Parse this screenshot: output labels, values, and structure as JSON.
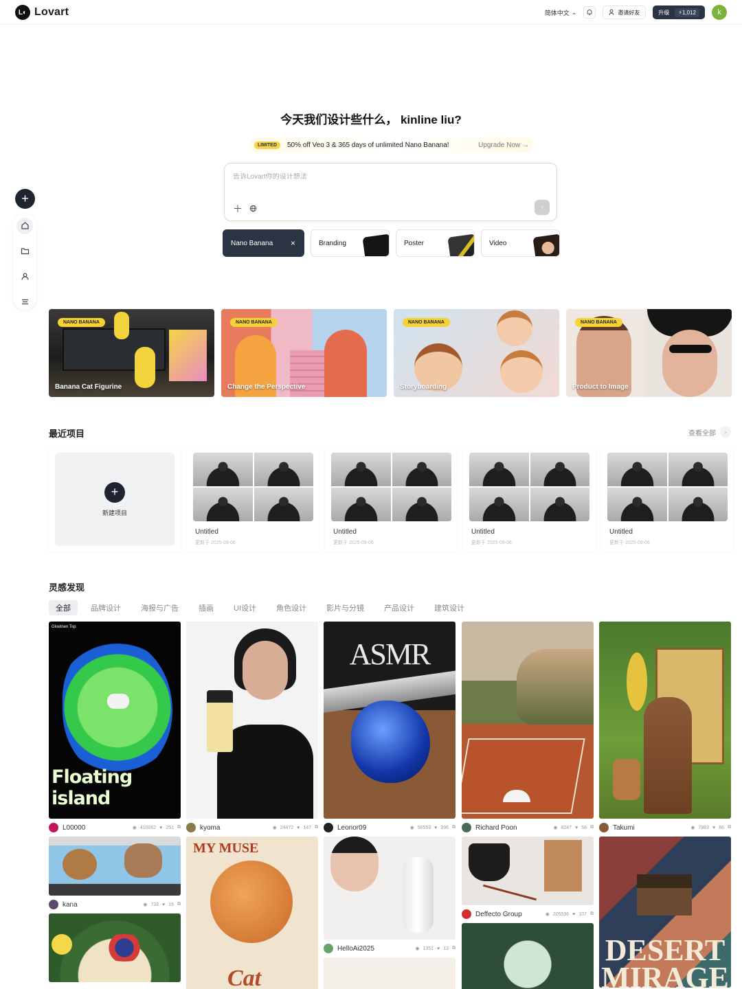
{
  "app": {
    "name": "Lovart",
    "logo_mark": "L◐"
  },
  "topbar": {
    "language": "简体中文",
    "invite_label": "邀请好友",
    "upgrade_label": "升级",
    "credits": "1,012",
    "avatar_letter": "k"
  },
  "hero": {
    "title": "今天我们设计些什么，   kinline liu?",
    "promo_badge": "LIMITED",
    "promo_text": "50% off Veo 3 & 365 days of unlimited Nano Banana!",
    "promo_link": "Upgrade Now →",
    "prompt_placeholder": "告诉Lovart你的设计想法"
  },
  "chips": [
    {
      "label": "Nano Banana",
      "active": true
    },
    {
      "label": "Branding"
    },
    {
      "label": "Poster"
    },
    {
      "label": "Video"
    }
  ],
  "features": [
    {
      "badge": "NANO BANANA",
      "label": "Banana Cat Figurine"
    },
    {
      "badge": "NANO BANANA",
      "label": "Change the Perspective"
    },
    {
      "badge": "NANO BANANA",
      "label": "Storyboarding"
    },
    {
      "badge": "NANO BANANA",
      "label": "Product to Image"
    }
  ],
  "recent": {
    "title": "最近项目",
    "view_all": "查看全部",
    "new_label": "新建项目",
    "items": [
      {
        "title": "Untitled",
        "date": "更新于 2025-09-06"
      },
      {
        "title": "Untitled",
        "date": "更新于 2025-09-06"
      },
      {
        "title": "Untitled",
        "date": "更新于 2025-09-06"
      },
      {
        "title": "Untitled",
        "date": "更新于 2025-09-06"
      }
    ]
  },
  "inspiration": {
    "title": "灵感发现",
    "tabs": [
      "全部",
      "品牌设计",
      "海报与广告",
      "插画",
      "UI设计",
      "角色设计",
      "影片与分镜",
      "产品设计",
      "建筑设计"
    ],
    "cards": {
      "c1": {
        "user": "L00000",
        "views": "410062",
        "likes": "251",
        "caption": "Floating island",
        "corner": "Gloetnen Top"
      },
      "c2": {
        "user": "kyoma",
        "views": "24472",
        "likes": "147"
      },
      "c3": {
        "user": "Leonor09",
        "views": "56559",
        "likes": "396",
        "caption": "ASMR"
      },
      "c4": {
        "user": "Richard Poon",
        "views": "8247",
        "likes": "58"
      },
      "c5": {
        "user": "Takumi",
        "views": "7883",
        "likes": "86"
      },
      "c6": {
        "user": "kana",
        "views": "733",
        "likes": "16"
      },
      "c7": {
        "caption": "MY MUSE",
        "caption2": "Cat"
      },
      "c8": {
        "user": "HelloAi2025",
        "views": "1351",
        "likes": "13"
      },
      "c9": {
        "user": "Deffecto Group",
        "views": "205536",
        "likes": "107"
      },
      "c10": {
        "caption": "DESERT MIRAGE"
      }
    }
  }
}
